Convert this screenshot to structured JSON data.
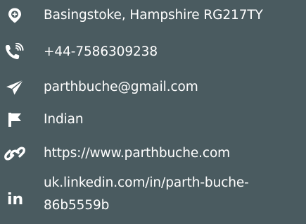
{
  "contact": {
    "address": "Basingstoke, Hampshire RG217TY",
    "phone": "+44-7586309238",
    "email": "parthbuche@gmail.com",
    "nationality": "Indian",
    "website": "https://www.parthbuche.com",
    "linkedin_line1": "uk.linkedin.com/in/parth-buche-",
    "linkedin_line2": "86b5559b",
    "linkedin_icon_text": "in"
  },
  "icons": [
    "location-pin-icon",
    "phone-call-icon",
    "paper-plane-icon",
    "flag-icon",
    "link-icon",
    "linkedin-icon"
  ],
  "colors": {
    "background": "#4a5b60",
    "foreground": "#ffffff"
  }
}
